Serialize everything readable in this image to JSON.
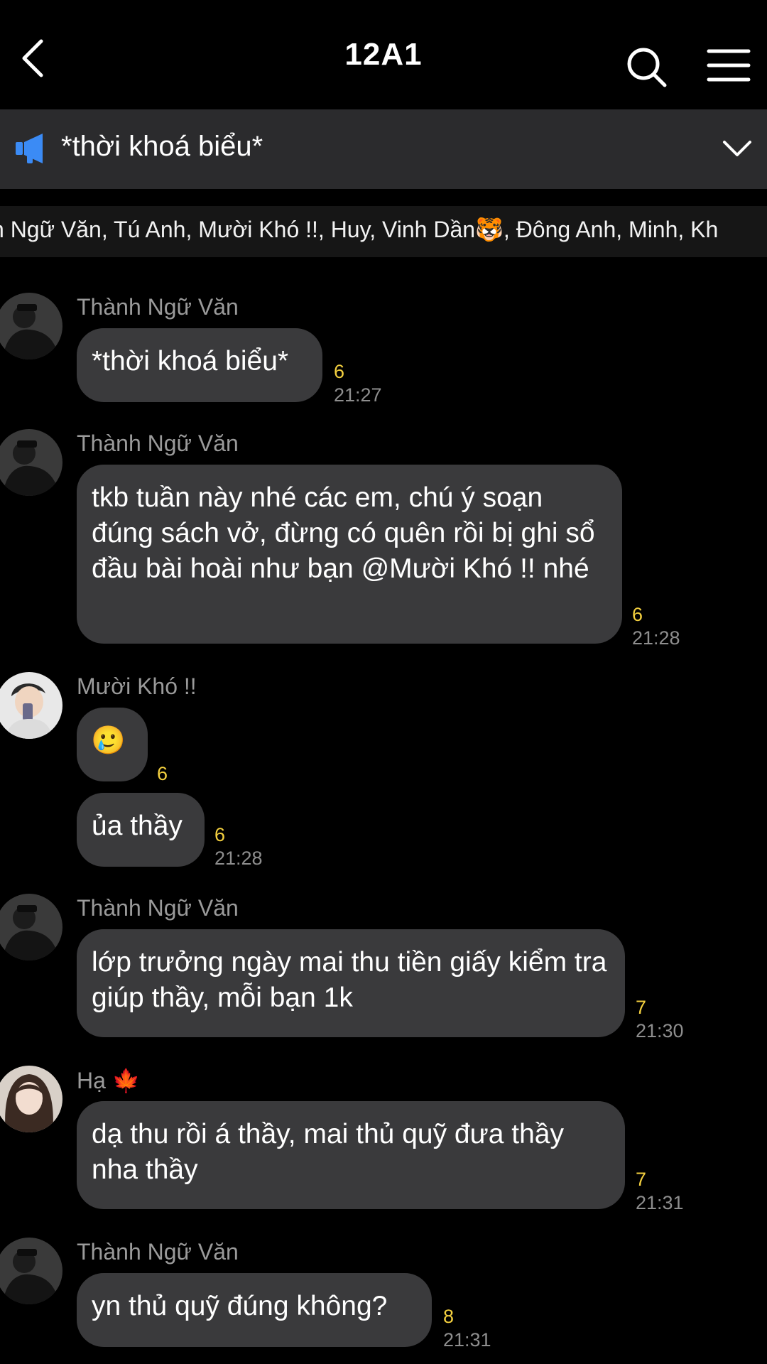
{
  "header": {
    "title": "12A1"
  },
  "pinned": {
    "text": "*thời khoá biểu*"
  },
  "members": {
    "text": "n Ngữ Văn, Tú Anh, Mười Khó !!, Huy, Vinh Dần🐯, Đông Anh, Minh, Kh"
  },
  "colors": {
    "background": "#000000",
    "bubble": "#3a3a3c",
    "banner": "#2b2b2d",
    "pin_icon": "#3b8bf5",
    "count": "#f4d03f"
  },
  "messages": [
    {
      "sender": "Thành Ngữ Văn",
      "text": "*thời khoá biểu*",
      "count": "6",
      "time": "21:27"
    },
    {
      "sender": "Thành Ngữ Văn",
      "text": "tkb tuần này nhé các em, chú ý soạn đúng sách vở, đừng có quên rồi bị ghi sổ đầu bài hoài như bạn @Mười Khó !! nhé",
      "count": "6",
      "time": "21:28"
    },
    {
      "sender": "Mười Khó !!",
      "text": "🥲",
      "count": "6"
    },
    {
      "text": "ủa thầy",
      "count": "6",
      "time": "21:28"
    },
    {
      "sender": "Thành Ngữ Văn",
      "text": "lớp trưởng ngày mai thu tiền giấy kiểm tra giúp thầy, mỗi bạn 1k",
      "count": "7",
      "time": "21:30"
    },
    {
      "sender": "Hạ 🍁",
      "text": "dạ thu rồi á thầy, mai thủ quỹ đưa thầy nha thầy",
      "count": "7",
      "time": "21:31"
    },
    {
      "sender": "Thành Ngữ Văn",
      "text": "yn thủ quỹ đúng không?",
      "count": "8",
      "time": "21:31"
    }
  ]
}
